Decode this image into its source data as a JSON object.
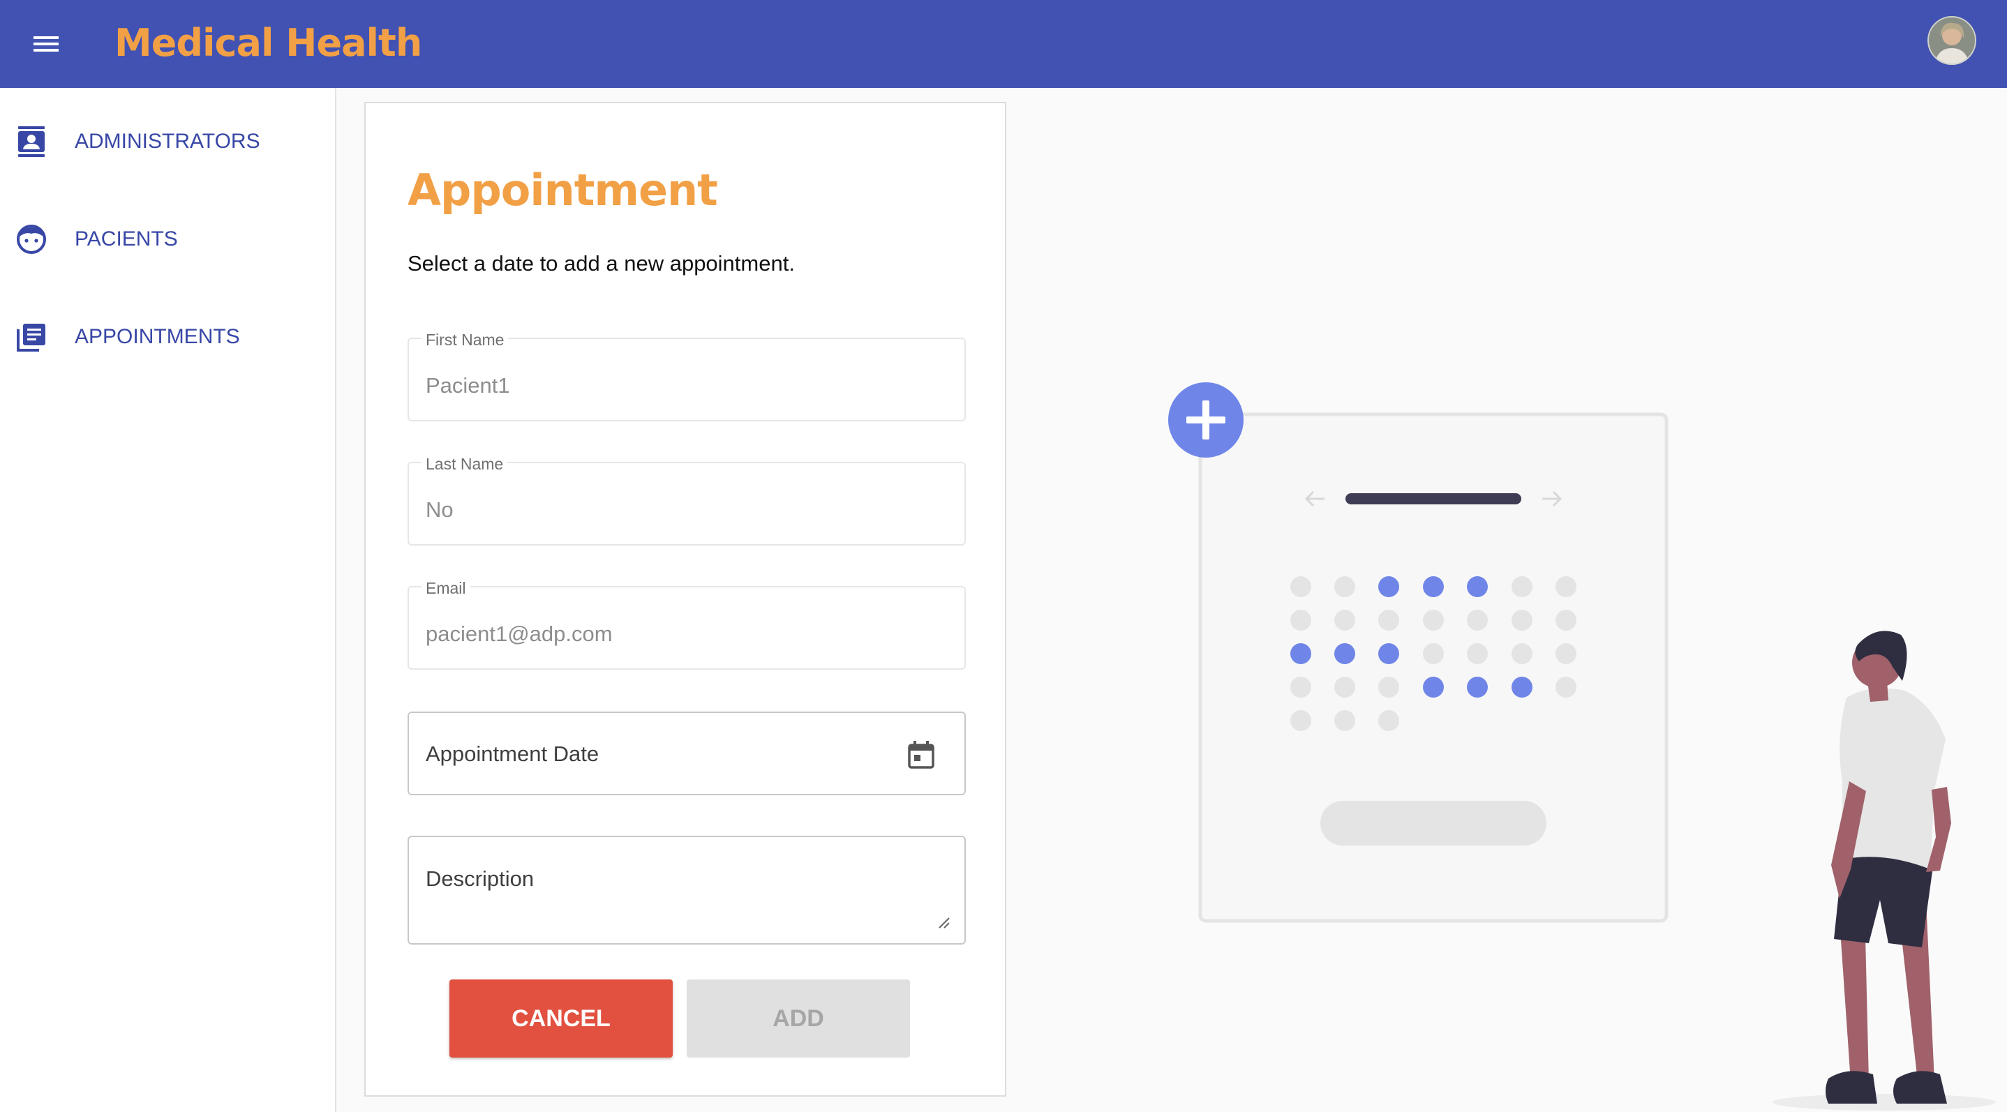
{
  "header": {
    "title": "Medical Health",
    "menu_icon": "hamburger-menu-icon",
    "avatar_icon": "user-avatar",
    "colors": {
      "bar": "#4152b3",
      "title": "#f2a046"
    }
  },
  "sidebar": {
    "items": [
      {
        "label": "ADMINISTRATORS",
        "icon": "contact-card-icon"
      },
      {
        "label": "PACIENTS",
        "icon": "face-icon"
      },
      {
        "label": "APPOINTMENTS",
        "icon": "list-stack-icon"
      }
    ],
    "accent": "#3847a6"
  },
  "form": {
    "title": "Appointment",
    "subtitle": "Select a date to add a new appointment.",
    "first_name": {
      "label": "First Name",
      "value": "Pacient1"
    },
    "last_name": {
      "label": "Last Name",
      "value": "No"
    },
    "email": {
      "label": "Email",
      "value": "pacient1@adp.com"
    },
    "appointment_date": {
      "placeholder": "Appointment Date",
      "icon": "calendar-icon"
    },
    "description": {
      "placeholder": "Description"
    },
    "cancel_label": "CANCEL",
    "add_label": "ADD",
    "colors": {
      "cancel": "#e25140",
      "add_disabled": "#e0e0e0"
    }
  },
  "illustration": {
    "subject": "person looking at a calendar with a plus icon",
    "colors": {
      "dot_active": "#6f86e8",
      "dot_inactive": "#e4e4e4",
      "plus_circle": "#6f86e8"
    }
  }
}
